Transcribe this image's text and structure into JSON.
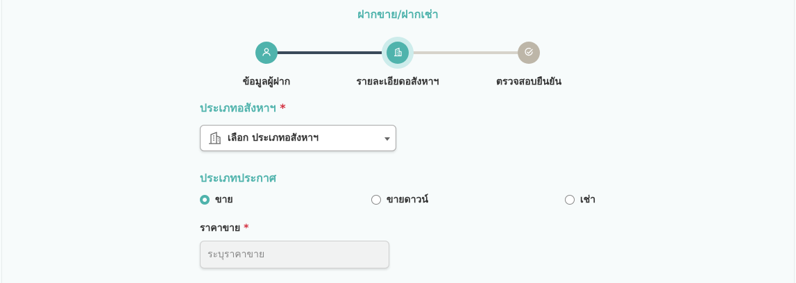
{
  "page": {
    "title": "ฝากขาย/ฝากเช่า"
  },
  "stepper": {
    "steps": [
      {
        "label": "ข้อมูลผู้ฝาก",
        "icon": "user-icon"
      },
      {
        "label": "รายละเอียดอสังหาฯ",
        "icon": "building-icon"
      },
      {
        "label": "ตรวจสอบยืนยัน",
        "icon": "check-circle-icon"
      }
    ],
    "active_step": 2,
    "colors": {
      "done": "#4fb3ac",
      "pending": "#bdb6a8",
      "line_done": "#3a4a5a",
      "line_pending": "#d6d3ca"
    }
  },
  "property_type": {
    "label": "ประเภทอสังหาฯ",
    "required_mark": "*",
    "select_value": "เลือก ประเภทอสังหาฯ",
    "icon": "building-icon"
  },
  "listing_type": {
    "label": "ประเภทประกาศ",
    "options": [
      {
        "label": "ขาย",
        "selected": true
      },
      {
        "label": "ขายดาวน์",
        "selected": false
      },
      {
        "label": "เช่า",
        "selected": false
      }
    ]
  },
  "price": {
    "label": "ราคาขาย",
    "required_mark": "*",
    "placeholder": "ระบุราคาขาย",
    "value": ""
  },
  "theme": {
    "accent": "#4fb3ac",
    "required": "#d32f3f"
  }
}
